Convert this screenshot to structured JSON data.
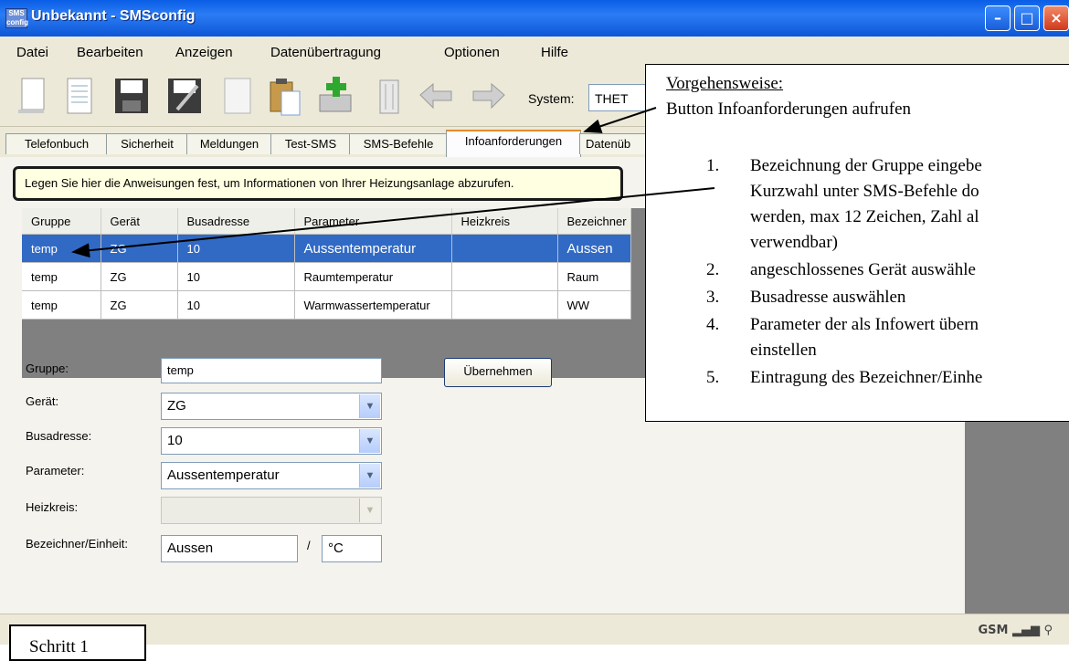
{
  "window": {
    "title": "Unbekannt - SMSconfig",
    "app_icon_text": "SMS config"
  },
  "menu": [
    {
      "label": "Datei",
      "mnemonic": "D"
    },
    {
      "label": "Bearbeiten",
      "mnemonic": "B"
    },
    {
      "label": "Anzeigen",
      "mnemonic": "n"
    },
    {
      "label": "Datenübertragung",
      "mnemonic": "t"
    },
    {
      "label": "Optionen",
      "mnemonic": "O"
    },
    {
      "label": "Hilfe",
      "mnemonic": "H"
    }
  ],
  "toolbar": {
    "icons": [
      "new-document-icon",
      "open-list-icon",
      "save-icon",
      "save-as-icon",
      "blank-page-icon",
      "paste-icon",
      "add-icon",
      "delete-icon",
      "transfer-left-icon",
      "transfer-right-icon"
    ],
    "system_label": "System:",
    "system_value": "THET"
  },
  "tabs": [
    "Telefonbuch",
    "Sicherheit",
    "Meldungen",
    "Test-SMS",
    "SMS-Befehle",
    "Infoanforderungen",
    "Datenüb"
  ],
  "active_tab": "Infoanforderungen",
  "info_text": "Legen Sie hier die Anweisungen fest, um Informationen von Ihrer Heizungsanlage abzurufen.",
  "table": {
    "columns": [
      "Gruppe",
      "Gerät",
      "Busadresse",
      "Parameter",
      "Heizkreis",
      "Bezeichner"
    ],
    "rows": [
      [
        "temp",
        "ZG",
        "10",
        "Aussentemperatur",
        "",
        "Aussen"
      ],
      [
        "temp",
        "ZG",
        "10",
        "Raumtemperatur",
        "",
        "Raum"
      ],
      [
        "temp",
        "ZG",
        "10",
        "Warmwassertemperatur",
        "",
        "WW"
      ]
    ],
    "selected_row": 0
  },
  "form": {
    "gruppe_label": "Gruppe:",
    "gruppe_value": "temp",
    "geraet_label": "Gerät:",
    "geraet_value": "ZG",
    "busadresse_label": "Busadresse:",
    "busadresse_value": "10",
    "parameter_label": "Parameter:",
    "parameter_value": "Aussentemperatur",
    "heizkreis_label": "Heizkreis:",
    "heizkreis_value": "",
    "bezeichner_label": "Bezeichner/Einheit:",
    "bezeichner_value": "Aussen",
    "separator": "/",
    "einheit_value": "°C",
    "apply_button": "Übernehmen"
  },
  "callout": {
    "heading": "Vorgehensweise:",
    "subtitle": "Button Infoanforderungen aufrufen",
    "steps": [
      {
        "num": "1.",
        "lines": [
          "Bezeichnung der Gruppe eingebe",
          "Kurzwahl unter SMS-Befehle do",
          "werden, max 12 Zeichen, Zahl al",
          "verwendbar)"
        ]
      },
      {
        "num": "2.",
        "lines": [
          "angeschlossenes Gerät auswähle"
        ]
      },
      {
        "num": "3.",
        "lines": [
          "Busadresse auswählen"
        ]
      },
      {
        "num": "4.",
        "lines": [
          "Parameter der als Infowert übern",
          "einstellen"
        ]
      },
      {
        "num": "5.",
        "lines": [
          "Eintragung des Bezeichner/Einhe"
        ]
      }
    ]
  },
  "step_box": "Schritt 1",
  "status": {
    "gsm_label": "GSM"
  },
  "colors": {
    "titlebar": "#0a5ee6",
    "selection": "#316ac5",
    "tab_highlight": "#e68b2c",
    "info_background": "#ffffe1"
  }
}
